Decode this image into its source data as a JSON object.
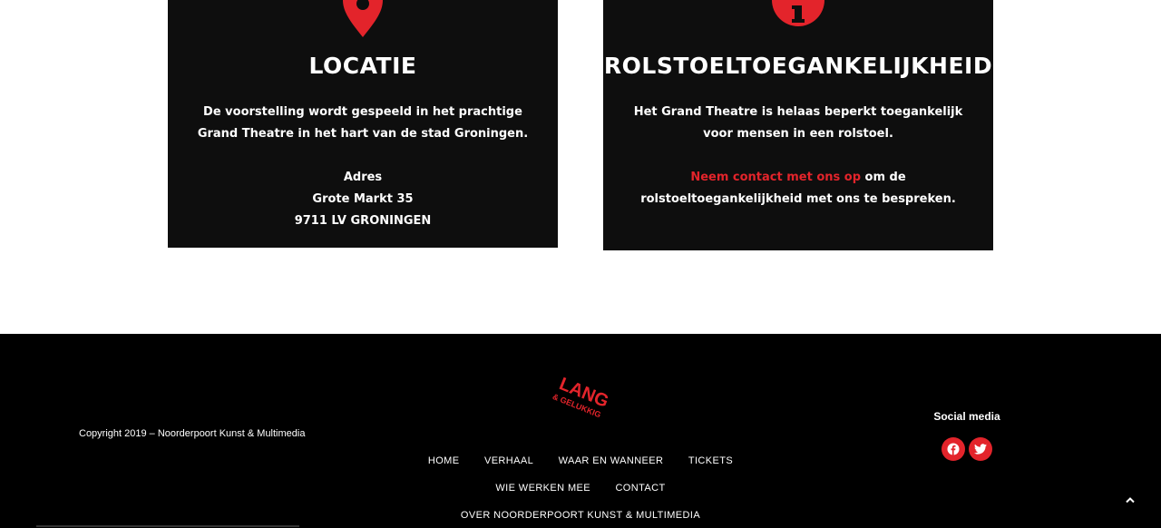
{
  "cards": {
    "locatie": {
      "icon": "map-pin-icon",
      "title": "LOCATIE",
      "intro": "De voorstelling wordt gespeeld in het prachtige Grand Theatre in het hart van de stad Groningen.",
      "address_label": "Adres",
      "street": "Grote Markt 35",
      "city": "9711 LV GRONINGEN"
    },
    "access": {
      "icon": "info-icon",
      "title": "ROLSTOELTOEGANKELIJKHEID",
      "intro": "Het Grand Theatre is helaas beperkt toegankelijk voor mensen in een rolstoel.",
      "contact_link": "Neem contact met ons op",
      "contact_rest": " om de rolstoeltoegankelijkheid met ons te bespreken."
    }
  },
  "footer": {
    "logo_text_top": "LANG",
    "logo_text_bottom": "& GELUKKIG",
    "copyright": "Copyright 2019 – Noorderpoort Kunst & Multimedia",
    "social_title": "Social media",
    "social": [
      "facebook-icon",
      "twitter-icon"
    ],
    "nav": {
      "home": "HOME",
      "verhaal": "VERHAAL",
      "waar": "WAAR EN WANNEER",
      "tickets": "TICKETS",
      "wie": "WIE WERKEN MEE",
      "contact": "CONTACT",
      "over": "OVER NOORDERPOORT KUNST & MULTIMEDIA"
    },
    "scroll_top_icon": "chevron-up-icon"
  },
  "colors": {
    "accent": "#e3242b",
    "card_bg": "#0e0e0e",
    "footer_bg": "#000000"
  }
}
